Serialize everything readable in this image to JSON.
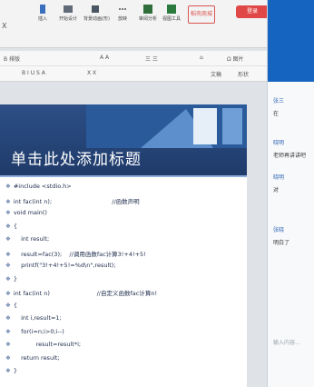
{
  "ribbon": {
    "tools": [
      {
        "label": "插入",
        "icon": "insert-icon"
      },
      {
        "label": "开始设计",
        "icon": "design-icon"
      },
      {
        "label": "背景动画(形)",
        "icon": "animation-icon"
      },
      {
        "label": "放映",
        "icon": "slideshow-icon"
      },
      {
        "label": "审阅分析",
        "icon": "review-icon"
      },
      {
        "label": "视图工具",
        "icon": "view-icon"
      }
    ],
    "badge_label": "稻壳商城",
    "login_label": "登录"
  },
  "format": {
    "row1": [
      "B 排版",
      "A A",
      "三 三",
      "⌂",
      "Ω 图片"
    ],
    "row2": [
      "B I U S A",
      "X X",
      "文稿",
      "形状"
    ]
  },
  "slide": {
    "title": "单击此处添加标题",
    "code_lines": [
      "#include <stdio.h>",
      "int fac(int n);                                //函数声明",
      "void main()",
      "{",
      "    int result;",
      "    result=fac(3);    //调用函数fac计算3!+4!+5!",
      "    printf(\"3!+4!+5!=%d\\n\",result);",
      "}",
      "int fac(int n)                         //自定义函数fac计算n!",
      "{",
      "    int i,result=1;",
      "    for(i=n;i>0;i--)",
      "            result=result*i;",
      "    return result;",
      "}"
    ]
  },
  "comments": [
    {
      "name": "张三",
      "text": "在"
    },
    {
      "name": "晓明",
      "text": "老师再讲讲吧"
    },
    {
      "name": "晓明",
      "text": "对"
    },
    {
      "name": "张晓",
      "text": "明白了"
    }
  ],
  "comment_input_placeholder": "输入内容..."
}
